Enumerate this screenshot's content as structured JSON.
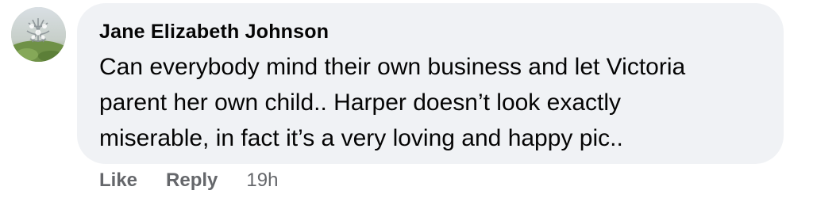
{
  "comment": {
    "author": "Jane Elizabeth Johnson",
    "text_lines": [
      "Can everybody mind their own business and let Victoria",
      "parent her own child.. Harper doesn’t look exactly",
      "miserable, in fact it’s a very loving and happy pic.."
    ],
    "avatar_icon": "profile-photo-avatar",
    "bubble_color": "#f0f2f5"
  },
  "actions": {
    "like_label": "Like",
    "reply_label": "Reply",
    "timestamp": "19h"
  }
}
